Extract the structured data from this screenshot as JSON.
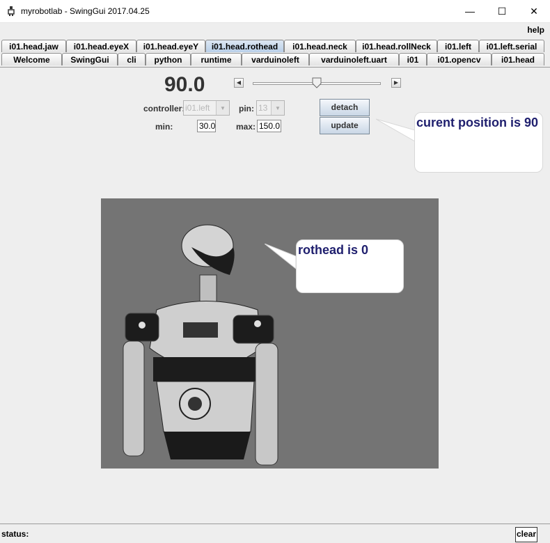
{
  "window": {
    "title": "myrobotlab - SwingGui 2017.04.25",
    "minimize_glyph": "—",
    "maximize_glyph": "☐",
    "close_glyph": "✕"
  },
  "menu": {
    "help_label": "help"
  },
  "tabs_row1": [
    "i01.head.jaw",
    "i01.head.eyeX",
    "i01.head.eyeY",
    "i01.head.rothead",
    "i01.head.neck",
    "i01.head.rollNeck",
    "i01.left",
    "i01.left.serial"
  ],
  "tabs_row2": [
    "Welcome",
    "SwingGui",
    "cli",
    "python",
    "runtime",
    "varduinoleft",
    "varduinoleft.uart",
    "i01",
    "i01.opencv",
    "i01.head"
  ],
  "active_tab": "i01.head.rothead",
  "servo": {
    "position_value": "90.0",
    "slider_min": 30,
    "slider_max": 150,
    "slider_value": 90,
    "controller_label": "controller:",
    "controller_value": "i01.left",
    "pin_label": "pin:",
    "pin_value": "13",
    "min_label": "min:",
    "min_value": "30.0",
    "max_label": "max:",
    "max_value": "150.0",
    "detach_label": "detach",
    "update_label": "update"
  },
  "bubbles": {
    "position_text": "curent position is 90",
    "rothead_text": "rothead is 0"
  },
  "status": {
    "label": "status:",
    "clear_label": "clear"
  },
  "colors": {
    "bubble_text": "#1f1f6e",
    "active_tab": "#b8cfe8",
    "viewport_bg": "#747474"
  }
}
